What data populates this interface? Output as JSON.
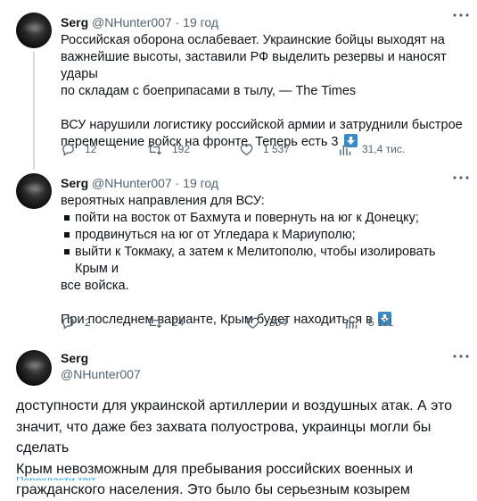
{
  "tweets": [
    {
      "author_name": "Serg",
      "handle": "@NHunter007",
      "separator": "·",
      "time": "19 год",
      "lines": [
        "Российская оборона ослабевает. Украинские бойцы выходят на",
        "важнейшие высоты, заставили РФ выделить резервы и наносят удары",
        "по складам с боеприпасами в тылу, — The Times"
      ],
      "lines2": [
        "ВСУ нарушили логистику российской армии и затруднили быстрое",
        "перемещение войск на фронте. Теперь есть 3"
      ],
      "replies": "12",
      "retweets": "192",
      "likes": "1 537",
      "views": "31,4 тис."
    },
    {
      "author_name": "Serg",
      "handle": "@NHunter007",
      "separator": "·",
      "time": "19 год",
      "intro": "вероятных направления для ВСУ:",
      "bullets": [
        "пойти на восток от Бахмута и повернуть на юг к Донецку;",
        "продвинуться на юг от Угледара к Мариуполю;",
        "выйти к Токмаку, а затем к Мелитополю, чтобы изолировать Крым и"
      ],
      "bullet_cont": "все войска.",
      "tail": "При последнем варианте, Крым будет находиться в",
      "replies": "2",
      "retweets": "24",
      "likes": "304",
      "views": "5 111"
    }
  ],
  "focus_tweet": {
    "author_name": "Serg",
    "handle": "@NHunter007",
    "lines": [
      "доступности для украинской артиллерии и воздушных атак. А это",
      "значит, что даже без захвата полуострова, украинцы могли бы сделать",
      "Крым невозможным для пребывания российских военных и",
      "гражданского населения. Это было бы серьезным козырем"
    ],
    "cut_text": "Перекласти твіт"
  },
  "icons": {
    "reply": "reply-icon",
    "retweet": "retweet-icon",
    "like": "heart-icon",
    "views": "views-chart-icon",
    "more": "more-dots-icon",
    "emoji": "down-arrow-emoji-icon",
    "bullet": "black-square-bullet-icon"
  },
  "colors": {
    "text": "#0f1419",
    "muted": "#536471",
    "line": "#cfd9de",
    "emoji_blue": "#3b88c3"
  }
}
